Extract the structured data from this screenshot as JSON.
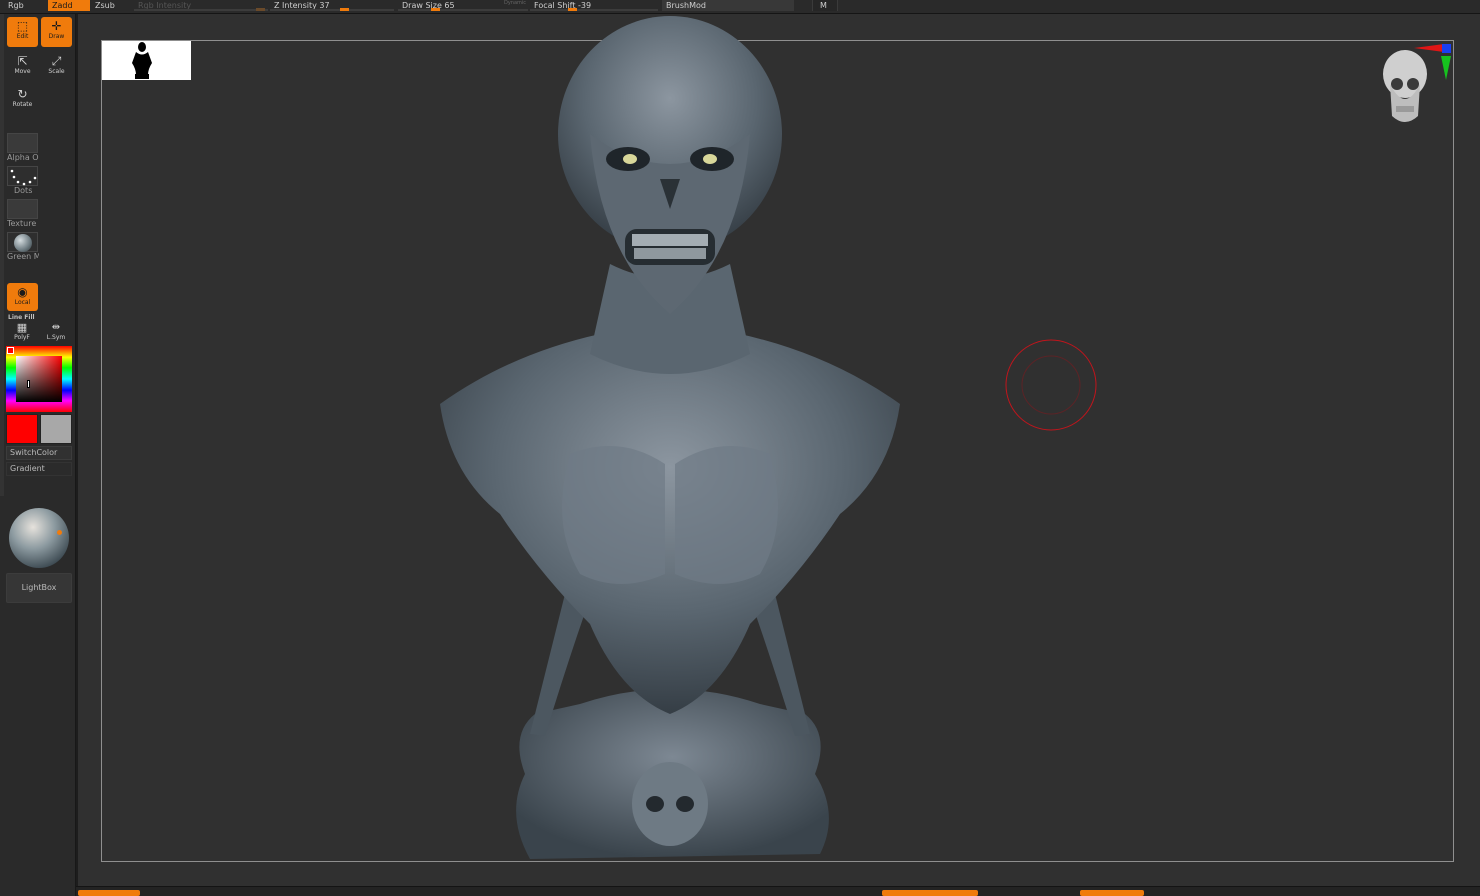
{
  "app": {
    "brand_color": "#f07b0c",
    "canvas_color": "#303030"
  },
  "topbar": {
    "rgb": "Rgb",
    "zadd": "Zadd",
    "zsub": "Zsub",
    "rgb_intensity": "Rgb Intensity",
    "z_intensity": "Z Intensity 37",
    "draw_size": "Draw Size 65",
    "dynamic": "Dynamic",
    "focal_shift": "Focal Shift -39",
    "brushmod": "BrushMod",
    "m": "M"
  },
  "left_shelf": {
    "edit": {
      "label": "Edit",
      "icon": "edit-icon"
    },
    "draw": {
      "label": "Draw",
      "icon": "draw-icon"
    },
    "move": {
      "label": "Move",
      "icon": "move-icon"
    },
    "scale": {
      "label": "Scale",
      "icon": "scale-icon"
    },
    "rotate": {
      "label": "Rotate",
      "icon": "rotate-icon"
    },
    "alpha": "Alpha O",
    "stroke": "Dots",
    "texture": "Texture",
    "material": "Green M",
    "local": "Local",
    "line_fill": "Line Fill",
    "polyf": "PolyF",
    "lsym": "L.Sym",
    "main_color": "#ff0000",
    "secondary_color": "#a8a8a8",
    "switch_color": "SwitchColor",
    "gradient": "Gradient",
    "lightbox": "LightBox"
  }
}
